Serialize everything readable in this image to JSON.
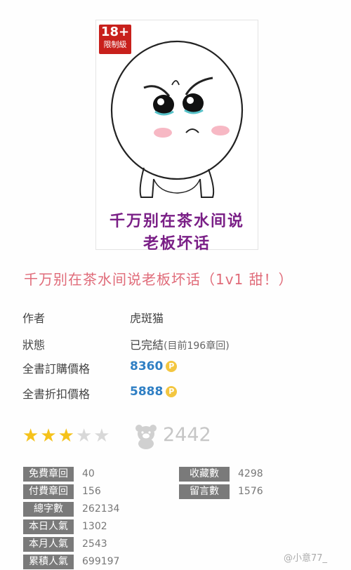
{
  "cover": {
    "badge_top": "18+",
    "badge_bottom": "限制級",
    "title_line1": "千万别在茶水间说",
    "title_line2": "老板坏话"
  },
  "book_title": "千万别在茶水间说老板坏话（1v1 甜！）",
  "info": {
    "author_label": "作者",
    "author": "虎斑猫",
    "status_label": "狀態",
    "status": "已完結",
    "status_note": "(目前196章回)",
    "price_label": "全書訂購價格",
    "price": "8360",
    "discount_label": "全書折扣價格",
    "discount_price": "5888",
    "coin_symbol": "P"
  },
  "rating": {
    "stars_filled": 3,
    "stars_total": 5,
    "fans": "2442"
  },
  "stats_left": [
    {
      "label": "免費章回",
      "value": "40"
    },
    {
      "label": "付費章回",
      "value": "156"
    },
    {
      "label": "總字數",
      "value": "262134"
    },
    {
      "label": "本日人氣",
      "value": "1302"
    },
    {
      "label": "本月人氣",
      "value": "2543"
    },
    {
      "label": "累積人氣",
      "value": "699197"
    }
  ],
  "stats_right": [
    {
      "label": "收藏數",
      "value": "4298"
    },
    {
      "label": "留言數",
      "value": "1576"
    }
  ],
  "watermark": "@小意77_",
  "colors": {
    "title": "#e06b79",
    "price": "#2f7fc4",
    "star": "#f5c21b",
    "label_bg": "#7a7a7a"
  }
}
